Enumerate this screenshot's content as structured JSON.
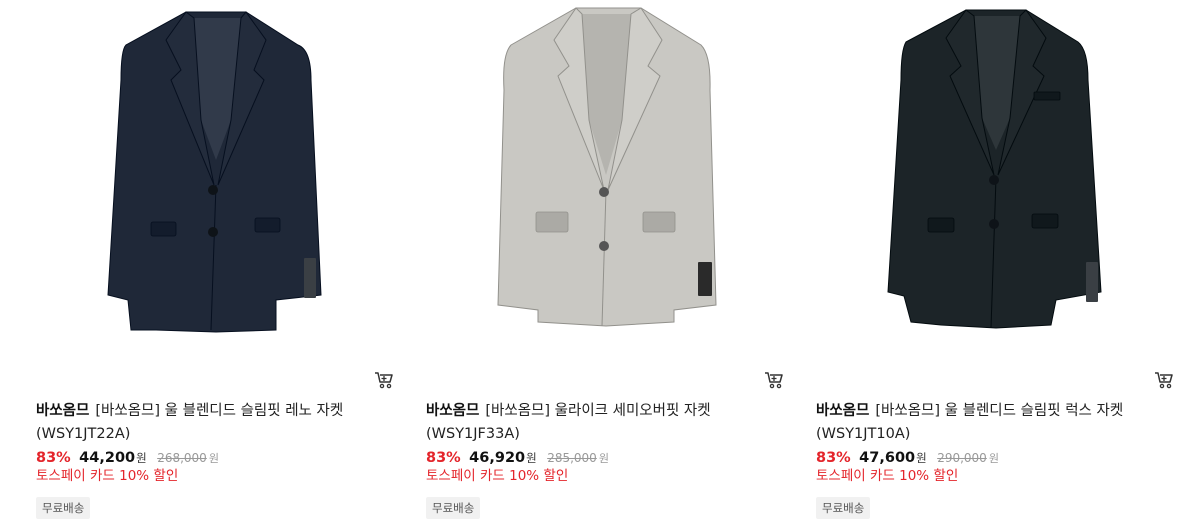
{
  "products": [
    {
      "brand": "바쏘옴므",
      "name": "[바쏘옴므] 울 블렌디드 슬림핏 레노 자켓 (WSY1JT22A)",
      "discount": "83%",
      "price": "44,200",
      "currency": "원",
      "original_price": "268,000",
      "promo": "토스페이 카드 10% 할인",
      "shipping_badge": "무료배송",
      "jacket_color": "#1f2838",
      "cart_icon": "cart-icon"
    },
    {
      "brand": "바쏘옴므",
      "name": "[바쏘옴므] 울라이크 세미오버핏 자켓 (WSY1JF33A)",
      "discount": "83%",
      "price": "46,920",
      "currency": "원",
      "original_price": "285,000",
      "promo": "토스페이 카드 10% 할인",
      "shipping_badge": "무료배송",
      "jacket_color": "#c9c8c3",
      "cart_icon": "cart-icon"
    },
    {
      "brand": "바쏘옴므",
      "name": "[바쏘옴므] 울 블렌디드 슬림핏 럭스 자켓 (WSY1JT10A)",
      "discount": "83%",
      "price": "47,600",
      "currency": "원",
      "original_price": "290,000",
      "promo": "토스페이 카드 10% 할인",
      "shipping_badge": "무료배송",
      "jacket_color": "#1c2428",
      "cart_icon": "cart-icon"
    }
  ]
}
